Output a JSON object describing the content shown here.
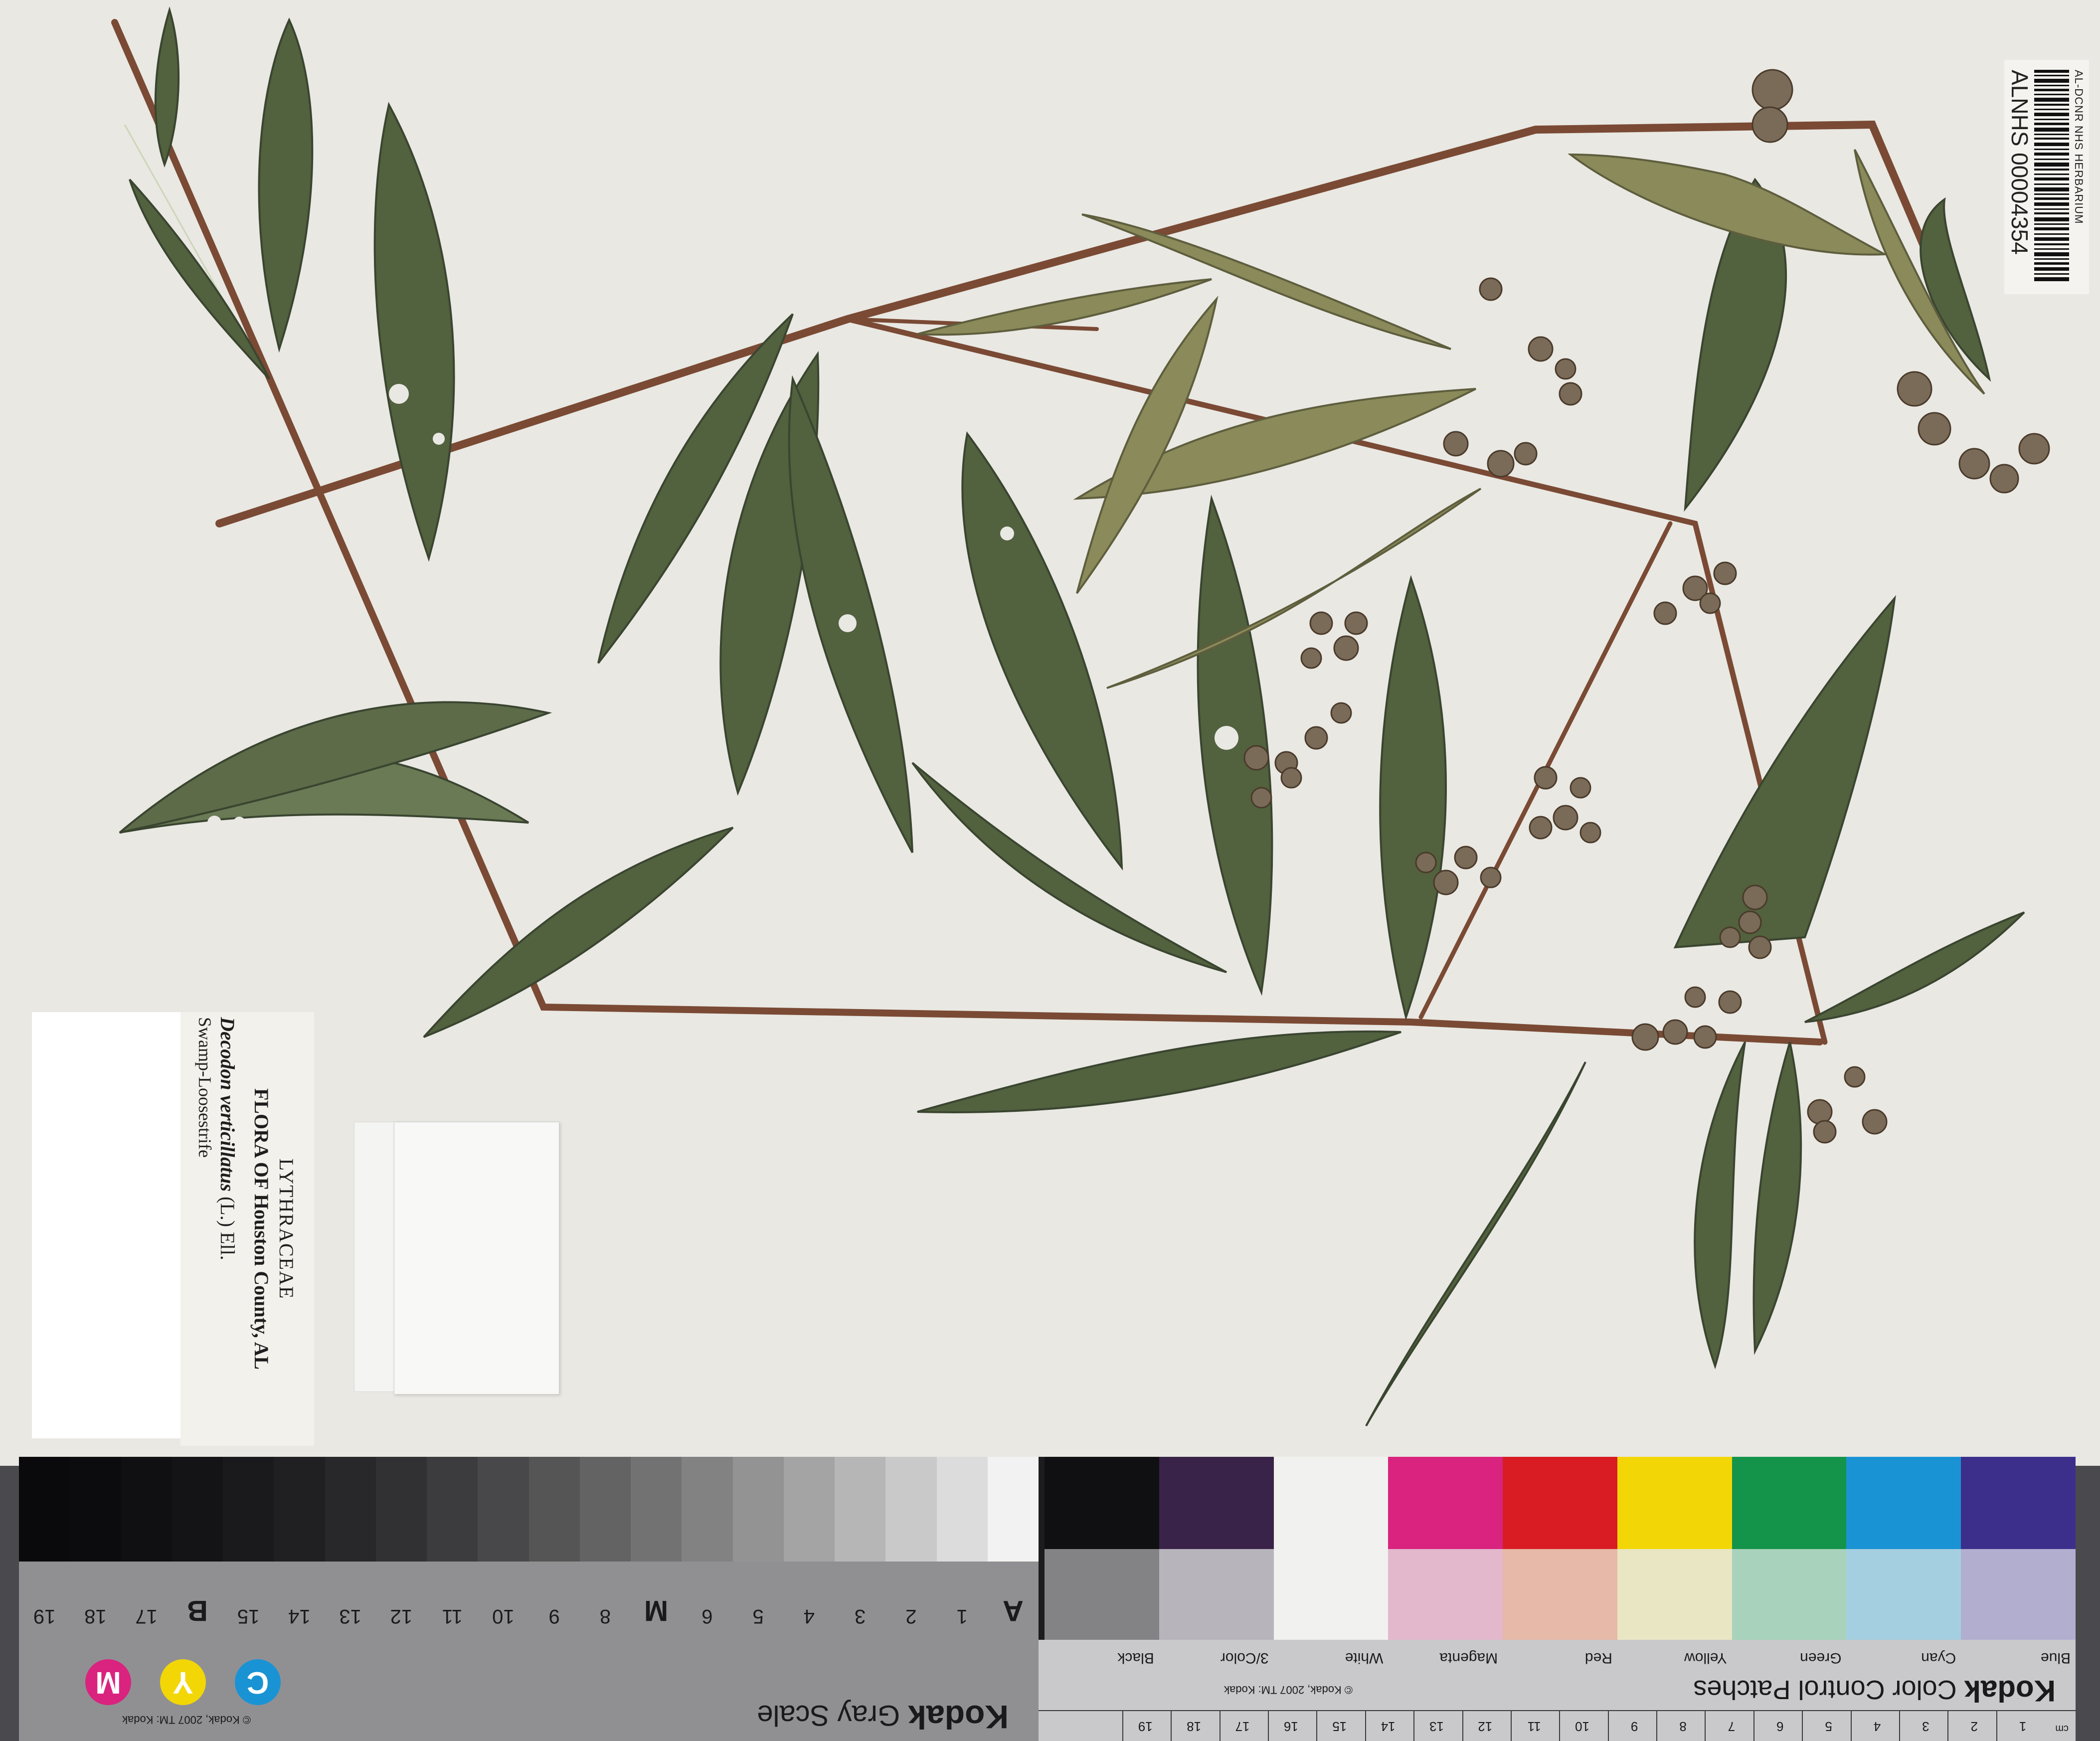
{
  "barcode_label": {
    "herbarium": "AL-DCNR NHS HERBARIUM",
    "catalog_number": "ALNHS 00004354"
  },
  "specimen_label": {
    "family": "LYTHRACEAE",
    "flora": "FLORA OF Houston County, AL",
    "scientific_name": "Decodon verticillatus",
    "authority": "(L.) Ell.",
    "common_name": "Swamp-Loosestrife"
  },
  "gray_scale_card": {
    "brand": "Kodak",
    "title": "Gray Scale",
    "copyright": "© Kodak, 2007 TM: Kodak",
    "scale_labels": [
      "A",
      "1",
      "2",
      "3",
      "4",
      "5",
      "6",
      "M",
      "8",
      "9",
      "10",
      "11",
      "12",
      "13",
      "14",
      "15",
      "B",
      "17",
      "18",
      "19"
    ],
    "cmy_circles": [
      "C",
      "Y",
      "M"
    ],
    "patch_colors": [
      "#f2f2f2",
      "#dcdcdc",
      "#c9c9c9",
      "#b6b6b7",
      "#a4a4a5",
      "#939394",
      "#828283",
      "#727273",
      "#636364",
      "#555556",
      "#48484a",
      "#3c3c3e",
      "#313133",
      "#28282a",
      "#202022",
      "#1a1a1c",
      "#141416",
      "#101012",
      "#0c0c0e",
      "#0a0a0c"
    ]
  },
  "color_card": {
    "brand": "Kodak",
    "title": "Color Control Patches",
    "copyright": "© Kodak, 2007 TM: Kodak",
    "patch_labels": [
      "Blue",
      "Cyan",
      "Green",
      "Yellow",
      "Red",
      "Magenta",
      "White",
      "3/Color",
      "Black"
    ],
    "ruler_unit": "cm",
    "ruler_numbers": [
      "1",
      "2",
      "3",
      "4",
      "5",
      "6",
      "7",
      "8",
      "9",
      "10",
      "11",
      "12",
      "13",
      "14",
      "15",
      "16",
      "17",
      "18",
      "19"
    ],
    "top_row_colors": [
      "#3c2f8c",
      "#1a93d4",
      "#14934a",
      "#f2d606",
      "#d91c24",
      "#d9237f",
      "#f1f1ef",
      "#3a2348",
      "#101012"
    ],
    "bottom_row_colors": [
      "#b1aed0",
      "#a4cfe0",
      "#a8d2bc",
      "#e9e6c3",
      "#e6b9a8",
      "#e3b8cc",
      "#f1f1ef",
      "#b7b4bc",
      "#838386"
    ]
  }
}
